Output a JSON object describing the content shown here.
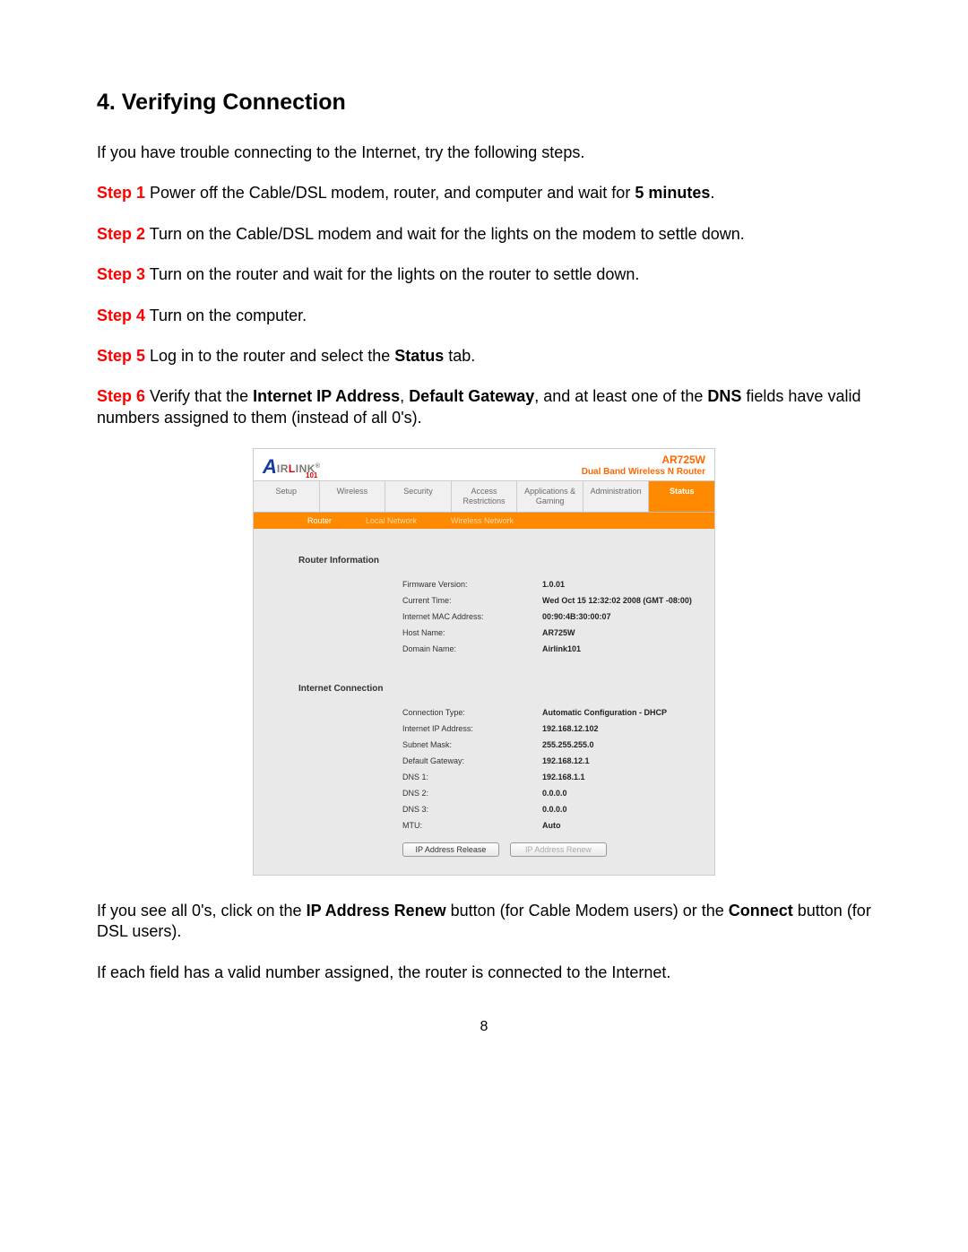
{
  "heading": "4. Verifying Connection",
  "intro": "If you have trouble connecting to the Internet, try the following steps.",
  "steps": {
    "s1": {
      "label": "Step 1",
      "text_a": " Power off the Cable/DSL modem, router, and computer and wait for ",
      "bold": "5 minutes",
      "text_b": "."
    },
    "s2": {
      "label": "Step 2",
      "text": " Turn on the Cable/DSL modem and wait for the lights on the modem to settle down."
    },
    "s3": {
      "label": "Step 3",
      "text": " Turn on the router and wait for the lights on the router to settle down."
    },
    "s4": {
      "label": "Step 4",
      "text": " Turn on the computer."
    },
    "s5": {
      "label": "Step 5",
      "text_a": " Log in to the router and select the ",
      "bold": "Status",
      "text_b": " tab."
    },
    "s6": {
      "label": "Step 6",
      "t1": " Verify that the ",
      "b1": "Internet IP Address",
      "t2": ", ",
      "b2": "Default Gateway",
      "t3": ", and at least one of the ",
      "b3": "DNS",
      "t4": " fields have valid numbers assigned to them (instead of all 0's)."
    }
  },
  "after1": {
    "t1": "If you see all 0's, click on the ",
    "b1": "IP Address Renew",
    "t2": " button (for Cable Modem users) or the ",
    "b2": "Connect",
    "t3": " button (for DSL users)."
  },
  "after2": "If each field has a valid number assigned, the router is connected to the Internet.",
  "page_number": "8",
  "router": {
    "logo": {
      "a": "A",
      "text1": "IR",
      "text2": "L",
      "text3": "INK",
      "sub": "101",
      "reg": "®"
    },
    "model": "AR725W",
    "model_desc": "Dual Band Wireless N Router",
    "maintabs": [
      "Setup",
      "Wireless",
      "Security",
      "Access Restrictions",
      "Applications & Gaming",
      "Administration",
      "Status"
    ],
    "maintab_active_index": 6,
    "subtabs": [
      "Router",
      "Local Network",
      "Wireless Network"
    ],
    "subtab_active_index": 0,
    "sections": {
      "router_info": {
        "title": "Router Information",
        "rows": [
          {
            "label": "Firmware Version:",
            "value": "1.0.01"
          },
          {
            "label": "Current Time:",
            "value": "Wed Oct 15 12:32:02 2008 (GMT -08:00)"
          },
          {
            "label": "Internet MAC Address:",
            "value": "00:90:4B:30:00:07"
          },
          {
            "label": "Host Name:",
            "value": "AR725W"
          },
          {
            "label": "Domain Name:",
            "value": "Airlink101"
          }
        ]
      },
      "internet": {
        "title": "Internet Connection",
        "rows": [
          {
            "label": "Connection Type:",
            "value": "Automatic Configuration - DHCP"
          },
          {
            "label": "Internet IP Address:",
            "value": "192.168.12.102"
          },
          {
            "label": "Subnet Mask:",
            "value": "255.255.255.0"
          },
          {
            "label": "Default Gateway:",
            "value": "192.168.12.1"
          },
          {
            "label": "DNS 1:",
            "value": "192.168.1.1"
          },
          {
            "label": "DNS 2:",
            "value": "0.0.0.0"
          },
          {
            "label": "DNS 3:",
            "value": "0.0.0.0"
          },
          {
            "label": "MTU:",
            "value": "Auto"
          }
        ]
      }
    },
    "buttons": {
      "release": "IP Address Release",
      "renew": "IP Address Renew"
    }
  }
}
